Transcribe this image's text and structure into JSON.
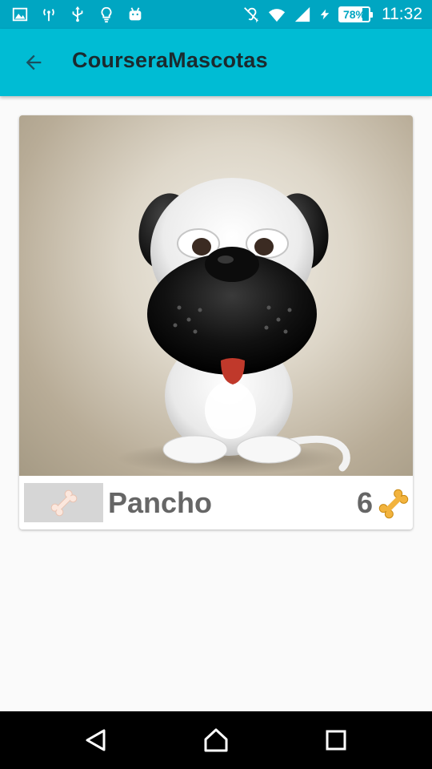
{
  "status_bar": {
    "battery_percent": "78%",
    "time": "11:32",
    "icons_left": [
      "image-icon",
      "antenna-icon",
      "usb-icon",
      "lightbulb-icon",
      "android-icon"
    ],
    "icons_right": [
      "hearing-icon",
      "wifi-icon",
      "signal-icon",
      "charging-icon",
      "battery-icon"
    ]
  },
  "app_bar": {
    "title": "CourseraMascotas",
    "background": "#00bcd4",
    "back_icon": "arrow-back-icon"
  },
  "pet": {
    "name": "Pancho",
    "likes": "6",
    "like_button_icon": "bone-icon",
    "rating_icon": "bone-icon",
    "rating_color": "#f2b33d"
  },
  "nav_bar": {
    "buttons": [
      "back-triangle-icon",
      "home-icon",
      "recents-icon"
    ]
  }
}
